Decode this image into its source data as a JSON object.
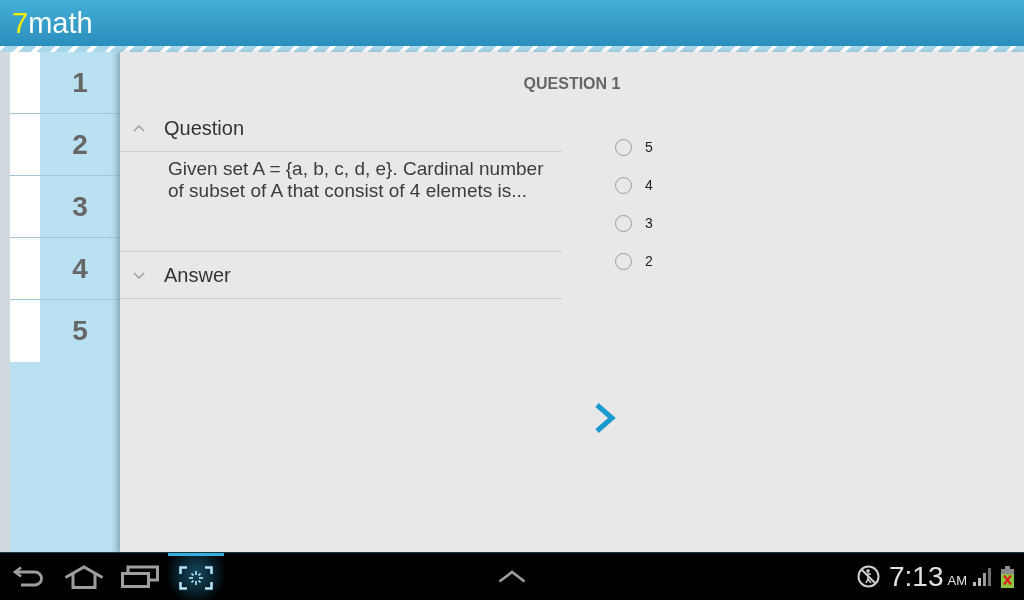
{
  "app_bar": {
    "title_accent": "7",
    "title_rest": "math"
  },
  "question_list": [
    {
      "number": "1"
    },
    {
      "number": "2"
    },
    {
      "number": "3"
    },
    {
      "number": "4"
    },
    {
      "number": "5"
    }
  ],
  "question_panel": {
    "heading": "QUESTION 1",
    "sections": [
      {
        "title": "Question",
        "expanded": true,
        "body": "Given set A = {a, b, c, d, e}. Cardinal number of subset of A that consist of 4 elemets is..."
      },
      {
        "title": "Answer",
        "expanded": false
      }
    ],
    "options": [
      {
        "label": "5",
        "selected": false
      },
      {
        "label": "4",
        "selected": false
      },
      {
        "label": "3",
        "selected": false
      },
      {
        "label": "2",
        "selected": false
      }
    ]
  },
  "system_bar": {
    "time": "7:13",
    "meridiem": "AM"
  }
}
